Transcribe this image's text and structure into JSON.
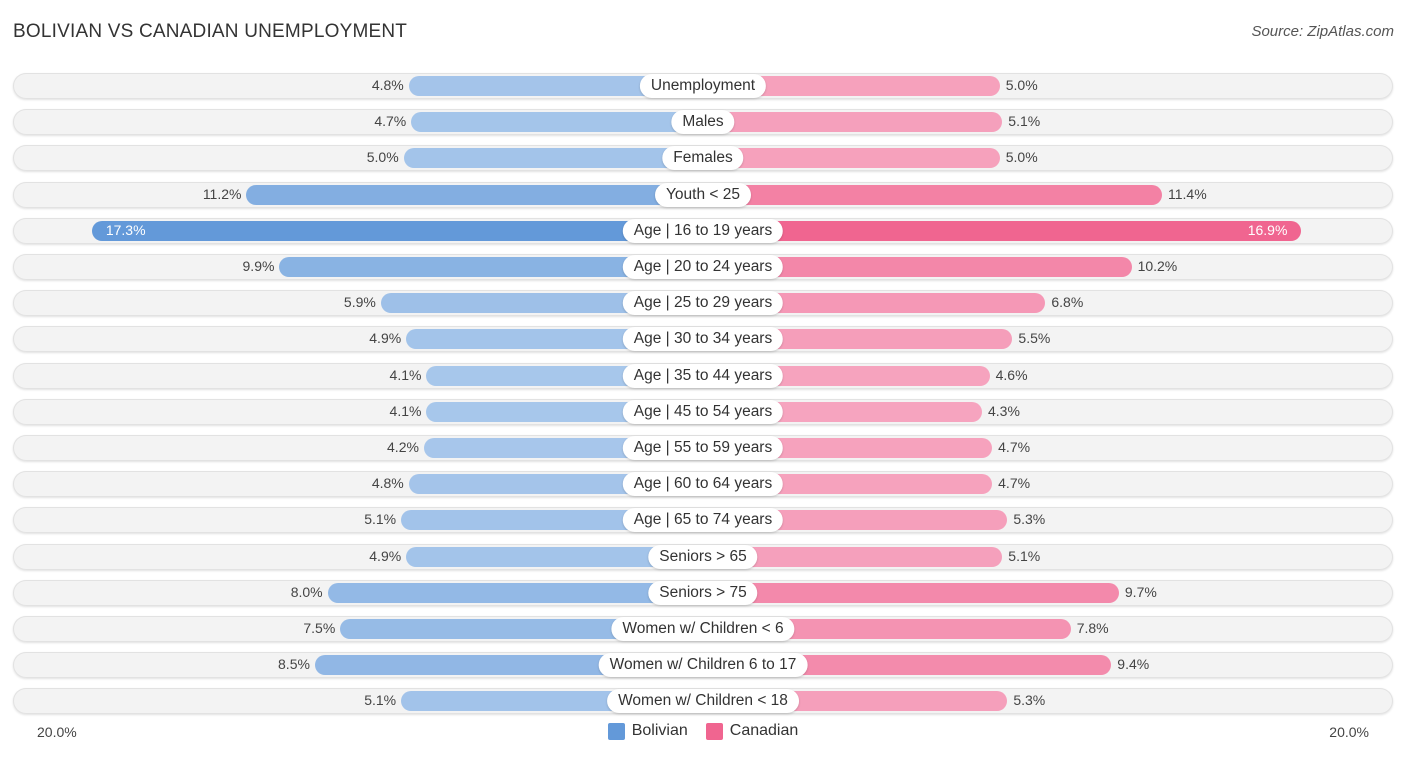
{
  "header": {
    "title": "BOLIVIAN VS CANADIAN UNEMPLOYMENT",
    "source": "Source: ZipAtlas.com"
  },
  "colors": {
    "bolivian_strong": "#6399d9",
    "bolivian_light": "#a8c7eb",
    "canadian_strong": "#f06590",
    "canadian_light": "#f6a6c0"
  },
  "chart_data": {
    "type": "bar",
    "orientation": "horizontal-diverging",
    "title": "BOLIVIAN VS CANADIAN UNEMPLOYMENT",
    "categories": [
      "Unemployment",
      "Males",
      "Females",
      "Youth < 25",
      "Age | 16 to 19 years",
      "Age | 20 to 24 years",
      "Age | 25 to 29 years",
      "Age | 30 to 34 years",
      "Age | 35 to 44 years",
      "Age | 45 to 54 years",
      "Age | 55 to 59 years",
      "Age | 60 to 64 years",
      "Age | 65 to 74 years",
      "Seniors > 65",
      "Seniors > 75",
      "Women w/ Children < 6",
      "Women w/ Children 6 to 17",
      "Women w/ Children < 18"
    ],
    "series": [
      {
        "name": "Bolivian",
        "values": [
          4.8,
          4.7,
          5.0,
          11.2,
          17.3,
          9.9,
          5.9,
          4.9,
          4.1,
          4.1,
          4.2,
          4.8,
          5.1,
          4.9,
          8.0,
          7.5,
          8.5,
          5.1
        ]
      },
      {
        "name": "Canadian",
        "values": [
          5.0,
          5.1,
          5.0,
          11.4,
          16.9,
          10.2,
          6.8,
          5.5,
          4.6,
          4.3,
          4.7,
          4.7,
          5.3,
          5.1,
          9.7,
          7.8,
          9.4,
          5.3
        ]
      }
    ],
    "value_labels": {
      "Bolivian": [
        "4.8%",
        "4.7%",
        "5.0%",
        "11.2%",
        "17.3%",
        "9.9%",
        "5.9%",
        "4.9%",
        "4.1%",
        "4.1%",
        "4.2%",
        "4.8%",
        "5.1%",
        "4.9%",
        "8.0%",
        "7.5%",
        "8.5%",
        "5.1%"
      ],
      "Canadian": [
        "5.0%",
        "5.1%",
        "5.0%",
        "11.4%",
        "16.9%",
        "10.2%",
        "6.8%",
        "5.5%",
        "4.6%",
        "4.3%",
        "4.7%",
        "4.7%",
        "5.3%",
        "5.1%",
        "9.7%",
        "7.8%",
        "9.4%",
        "5.3%"
      ]
    },
    "xlim": [
      -20,
      20
    ],
    "axis_labels": {
      "left": "20.0%",
      "right": "20.0%"
    },
    "legend": {
      "position": "bottom-center",
      "entries": [
        "Bolivian",
        "Canadian"
      ]
    },
    "grid": false
  }
}
